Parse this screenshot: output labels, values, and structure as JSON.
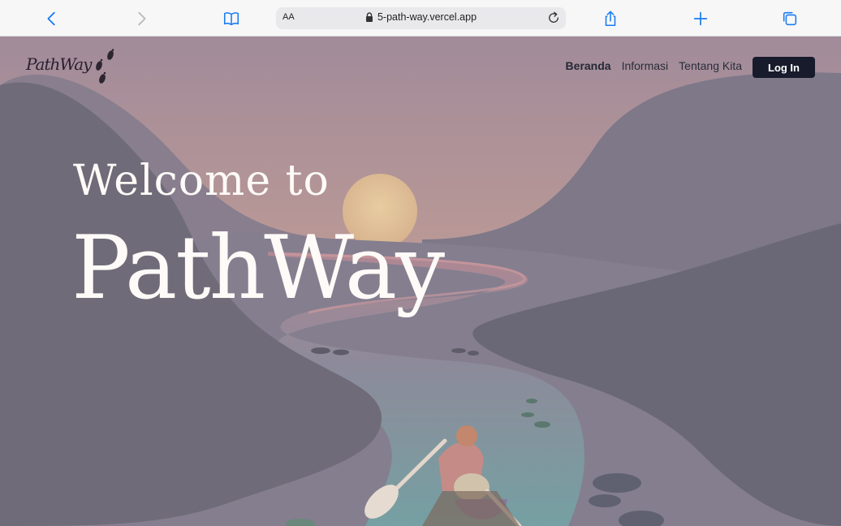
{
  "browser": {
    "text_size_label": "AA",
    "url": "5-path-way.vercel.app"
  },
  "nav": {
    "logo_text": "PathWay",
    "links": [
      {
        "label": "Beranda",
        "active": true
      },
      {
        "label": "Informasi",
        "active": false
      },
      {
        "label": "Tentang Kita",
        "active": false
      }
    ],
    "login_label": "Log In"
  },
  "hero": {
    "welcome": "Welcome to",
    "brand": "PathWay"
  },
  "colors": {
    "login_bg": "#171b2b",
    "sky_top": "#a48e9c",
    "sky_bottom": "#e0b78e",
    "mountains": "#6d6c79",
    "river": "#7fa6ab",
    "sun": "#e9c89a"
  },
  "icons": {
    "back": "chevron-left-icon",
    "forward": "chevron-right-icon",
    "bookmarks": "book-icon",
    "lock": "lock-icon",
    "reload": "reload-icon",
    "share": "share-icon",
    "new_tab": "plus-icon",
    "tabs": "tabs-icon"
  }
}
